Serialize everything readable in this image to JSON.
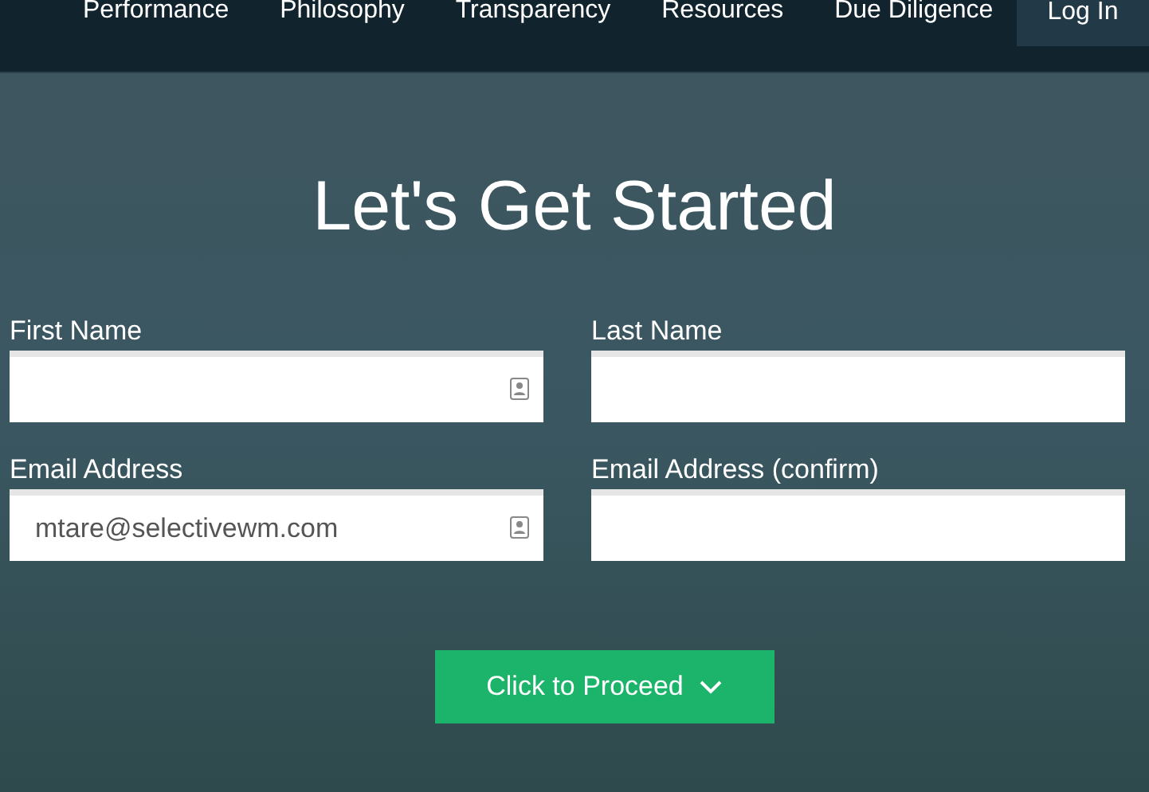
{
  "nav": {
    "items": [
      {
        "label": "Performance"
      },
      {
        "label": "Philosophy"
      },
      {
        "label": "Transparency"
      },
      {
        "label": "Resources"
      },
      {
        "label": "Due Diligence"
      }
    ],
    "login": "Log In"
  },
  "form": {
    "title": "Let's Get Started",
    "fields": [
      {
        "label": "First Name",
        "card_icon": true
      },
      {
        "label": "Last Name",
        "card_icon": false
      },
      {
        "label": "Email Address",
        "value": "mtare@selectivewm.com",
        "card_icon": true
      },
      {
        "label": "Email Address (confirm)",
        "card_icon": false
      }
    ],
    "button": "Click to Proceed"
  }
}
